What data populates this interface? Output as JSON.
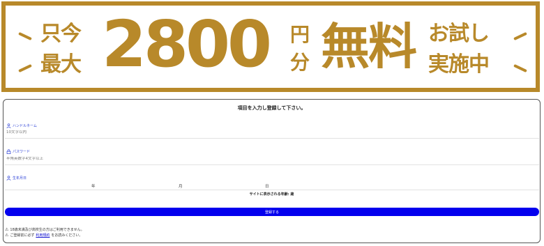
{
  "banner": {
    "left_top": "只今",
    "left_bottom": "最大",
    "amount": "2800",
    "unit_top": "円",
    "unit_bottom": "分",
    "free": "無料",
    "right_top": "お試し",
    "right_bottom": "実施中",
    "accent_color": "#b8892a"
  },
  "form": {
    "title": "項目を入力し登録して下さい。",
    "handle": {
      "label": "ハンドルネーム",
      "placeholder": "10文字以内",
      "icon": "user-icon"
    },
    "password": {
      "label": "パスワード",
      "placeholder": "半角英数字4文字以上",
      "icon": "lock-icon"
    },
    "birthday": {
      "label": "生年月日",
      "year_label": "年",
      "month_label": "月",
      "day_label": "日",
      "icon": "user-icon"
    },
    "age_text": "サイトに表示される年齢: 歳",
    "submit_label": "登録する",
    "submit_color": "#0400ee",
    "notes": [
      {
        "icon": "warning-icon",
        "text": "18歳未満及び高校生の方はご利用できません。"
      },
      {
        "icon": "warning-icon",
        "prefix": "ご登録前に必ず",
        "link": "利用規約",
        "suffix": "をお読みください。"
      }
    ]
  }
}
